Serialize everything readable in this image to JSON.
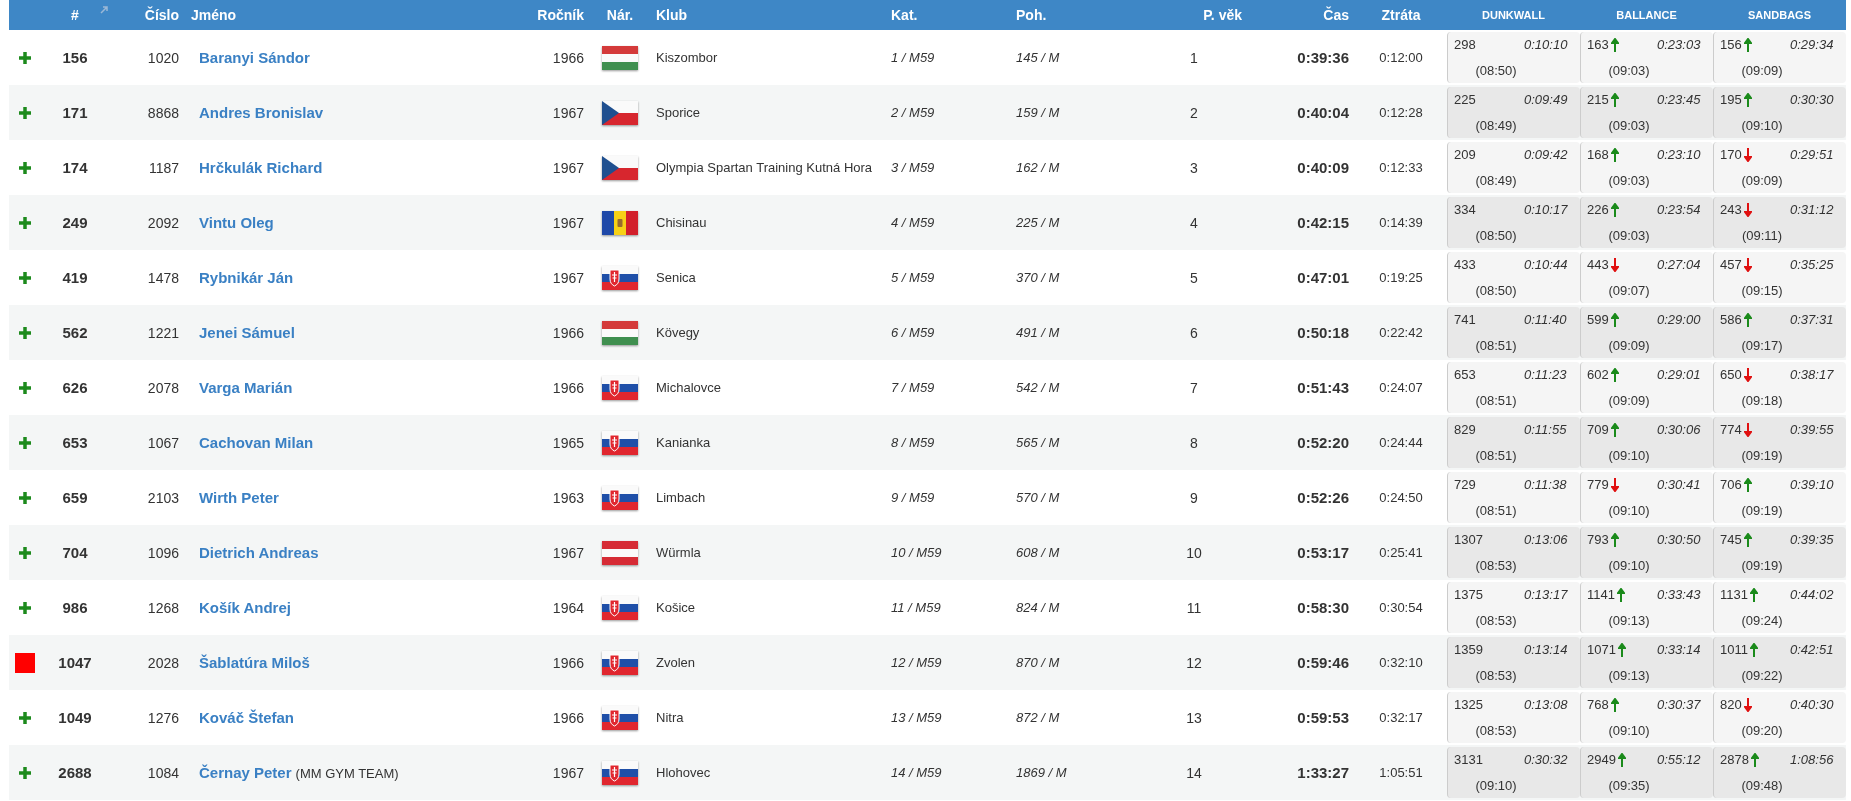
{
  "table": {
    "columns": [
      "#",
      "Číslo",
      "Jméno",
      "Ročník",
      "Nár.",
      "Klub",
      "Kat.",
      "Poh.",
      "P. věk",
      "Čas",
      "Ztráta"
    ],
    "split_columns": [
      "DUNKWALL",
      "BALLANCE",
      "SANDBAGS"
    ],
    "rows": [
      {
        "kind": "plus",
        "rank": "156",
        "number": "1020",
        "name": "Baranyi Sándor",
        "year": "1966",
        "flag": {
          "kind": "hu"
        },
        "club": "Kiszombor",
        "category": "1 / M59",
        "gender": "145 / M",
        "age_rank": "1",
        "time": "0:39:36",
        "loss": "0:12:00",
        "splits": [
          {
            "rank": "298",
            "time": "0:10:10",
            "lap": "(08:50)"
          },
          {
            "rank": "163",
            "improved": true,
            "time": "0:23:03",
            "lap": "(09:03)"
          },
          {
            "rank": "156",
            "improved": true,
            "time": "0:29:34",
            "lap": "(09:09)"
          }
        ]
      },
      {
        "kind": "plus",
        "rank": "171",
        "number": "8868",
        "name": "Andres Bronislav",
        "year": "1967",
        "flag": {
          "kind": "cz"
        },
        "club": "Sporice",
        "category": "2 / M59",
        "gender": "159 / M",
        "age_rank": "2",
        "time": "0:40:04",
        "loss": "0:12:28",
        "splits": [
          {
            "rank": "225",
            "time": "0:09:49",
            "lap": "(08:49)"
          },
          {
            "rank": "215",
            "improved": true,
            "time": "0:23:45",
            "lap": "(09:03)"
          },
          {
            "rank": "195",
            "improved": true,
            "time": "0:30:30",
            "lap": "(09:10)"
          }
        ]
      },
      {
        "kind": "plus",
        "rank": "174",
        "number": "1187",
        "name": "Hrčkulák Richard",
        "year": "1967",
        "flag": {
          "kind": "cz"
        },
        "club": "Olympia Spartan Training Kutná Hora",
        "category": "3 / M59",
        "gender": "162 / M",
        "age_rank": "3",
        "time": "0:40:09",
        "loss": "0:12:33",
        "splits": [
          {
            "rank": "209",
            "time": "0:09:42",
            "lap": "(08:49)"
          },
          {
            "rank": "168",
            "improved": true,
            "time": "0:23:10",
            "lap": "(09:03)"
          },
          {
            "rank": "170",
            "improved": false,
            "time": "0:29:51",
            "lap": "(09:09)"
          }
        ]
      },
      {
        "kind": "plus",
        "rank": "249",
        "number": "2092",
        "name": "Vintu Oleg",
        "year": "1967",
        "flag": {
          "kind": "md"
        },
        "club": "Chisinau",
        "category": "4 / M59",
        "gender": "225 / M",
        "age_rank": "4",
        "time": "0:42:15",
        "loss": "0:14:39",
        "splits": [
          {
            "rank": "334",
            "time": "0:10:17",
            "lap": "(08:50)"
          },
          {
            "rank": "226",
            "improved": true,
            "time": "0:23:54",
            "lap": "(09:03)"
          },
          {
            "rank": "243",
            "improved": false,
            "time": "0:31:12",
            "lap": "(09:11)"
          }
        ]
      },
      {
        "kind": "plus",
        "rank": "419",
        "number": "1478",
        "name": "Rybnikár Ján",
        "year": "1967",
        "flag": {
          "kind": "sk"
        },
        "club": "Senica",
        "category": "5 / M59",
        "gender": "370 / M",
        "age_rank": "5",
        "time": "0:47:01",
        "loss": "0:19:25",
        "splits": [
          {
            "rank": "433",
            "time": "0:10:44",
            "lap": "(08:50)"
          },
          {
            "rank": "443",
            "improved": false,
            "time": "0:27:04",
            "lap": "(09:07)"
          },
          {
            "rank": "457",
            "improved": false,
            "time": "0:35:25",
            "lap": "(09:15)"
          }
        ]
      },
      {
        "kind": "plus",
        "rank": "562",
        "number": "1221",
        "name": "Jenei Sámuel",
        "year": "1966",
        "flag": {
          "kind": "hu"
        },
        "club": "Kövegy",
        "category": "6 / M59",
        "gender": "491 / M",
        "age_rank": "6",
        "time": "0:50:18",
        "loss": "0:22:42",
        "splits": [
          {
            "rank": "741",
            "time": "0:11:40",
            "lap": "(08:51)"
          },
          {
            "rank": "599",
            "improved": true,
            "time": "0:29:00",
            "lap": "(09:09)"
          },
          {
            "rank": "586",
            "improved": true,
            "time": "0:37:31",
            "lap": "(09:17)"
          }
        ]
      },
      {
        "kind": "plus",
        "rank": "626",
        "number": "2078",
        "name": "Varga Marián",
        "year": "1966",
        "flag": {
          "kind": "sk"
        },
        "club": "Michalovce",
        "category": "7 / M59",
        "gender": "542 / M",
        "age_rank": "7",
        "time": "0:51:43",
        "loss": "0:24:07",
        "splits": [
          {
            "rank": "653",
            "time": "0:11:23",
            "lap": "(08:51)"
          },
          {
            "rank": "602",
            "improved": true,
            "time": "0:29:01",
            "lap": "(09:09)"
          },
          {
            "rank": "650",
            "improved": false,
            "time": "0:38:17",
            "lap": "(09:18)"
          }
        ]
      },
      {
        "kind": "plus",
        "rank": "653",
        "number": "1067",
        "name": "Cachovan Milan",
        "year": "1965",
        "flag": {
          "kind": "sk"
        },
        "club": "Kanianka",
        "category": "8 / M59",
        "gender": "565 / M",
        "age_rank": "8",
        "time": "0:52:20",
        "loss": "0:24:44",
        "splits": [
          {
            "rank": "829",
            "time": "0:11:55",
            "lap": "(08:51)"
          },
          {
            "rank": "709",
            "improved": true,
            "time": "0:30:06",
            "lap": "(09:10)"
          },
          {
            "rank": "774",
            "improved": false,
            "time": "0:39:55",
            "lap": "(09:19)"
          }
        ]
      },
      {
        "kind": "plus",
        "rank": "659",
        "number": "2103",
        "name": "Wirth Peter",
        "year": "1963",
        "flag": {
          "kind": "sk"
        },
        "club": "Limbach",
        "category": "9 / M59",
        "gender": "570 / M",
        "age_rank": "9",
        "time": "0:52:26",
        "loss": "0:24:50",
        "splits": [
          {
            "rank": "729",
            "time": "0:11:38",
            "lap": "(08:51)"
          },
          {
            "rank": "779",
            "improved": false,
            "time": "0:30:41",
            "lap": "(09:10)"
          },
          {
            "rank": "706",
            "improved": true,
            "time": "0:39:10",
            "lap": "(09:19)"
          }
        ]
      },
      {
        "kind": "plus",
        "rank": "704",
        "number": "1096",
        "name": "Dietrich Andreas",
        "year": "1967",
        "flag": {
          "kind": "at"
        },
        "club": "Würmla",
        "category": "10 / M59",
        "gender": "608 / M",
        "age_rank": "10",
        "time": "0:53:17",
        "loss": "0:25:41",
        "splits": [
          {
            "rank": "1307",
            "time": "0:13:06",
            "lap": "(08:53)"
          },
          {
            "rank": "793",
            "improved": true,
            "time": "0:30:50",
            "lap": "(09:10)"
          },
          {
            "rank": "745",
            "improved": true,
            "time": "0:39:35",
            "lap": "(09:19)"
          }
        ]
      },
      {
        "kind": "plus",
        "rank": "986",
        "number": "1268",
        "name": "Košík Andrej",
        "year": "1964",
        "flag": {
          "kind": "sk"
        },
        "club": "Košice",
        "category": "11 / M59",
        "gender": "824 / M",
        "age_rank": "11",
        "time": "0:58:30",
        "loss": "0:30:54",
        "splits": [
          {
            "rank": "1375",
            "time": "0:13:17",
            "lap": "(08:53)"
          },
          {
            "rank": "1141",
            "improved": true,
            "time": "0:33:43",
            "lap": "(09:13)"
          },
          {
            "rank": "1131",
            "improved": true,
            "time": "0:44:02",
            "lap": "(09:24)"
          }
        ]
      },
      {
        "kind": "square",
        "rank": "1047",
        "number": "2028",
        "name": "Šablatúra Miloš",
        "year": "1966",
        "flag": {
          "kind": "sk"
        },
        "club": "Zvolen",
        "category": "12 / M59",
        "gender": "870 / M",
        "age_rank": "12",
        "time": "0:59:46",
        "loss": "0:32:10",
        "splits": [
          {
            "rank": "1359",
            "time": "0:13:14",
            "lap": "(08:53)"
          },
          {
            "rank": "1071",
            "improved": true,
            "time": "0:33:14",
            "lap": "(09:13)"
          },
          {
            "rank": "1011",
            "improved": true,
            "time": "0:42:51",
            "lap": "(09:22)"
          }
        ]
      },
      {
        "kind": "plus",
        "rank": "1049",
        "number": "1276",
        "name": "Kováč Štefan",
        "year": "1966",
        "flag": {
          "kind": "sk"
        },
        "club": "Nitra",
        "category": "13 / M59",
        "gender": "872 / M",
        "age_rank": "13",
        "time": "0:59:53",
        "loss": "0:32:17",
        "splits": [
          {
            "rank": "1325",
            "time": "0:13:08",
            "lap": "(08:53)"
          },
          {
            "rank": "768",
            "improved": true,
            "time": "0:30:37",
            "lap": "(09:10)"
          },
          {
            "rank": "820",
            "improved": false,
            "time": "0:40:30",
            "lap": "(09:20)"
          }
        ]
      },
      {
        "kind": "plus",
        "rank": "2688",
        "number": "1084",
        "name": "Černay Peter",
        "team": "(MM GYM TEAM)",
        "year": "1967",
        "flag": {
          "kind": "sk"
        },
        "club": "Hlohovec",
        "category": "14 / M59",
        "gender": "1869 / M",
        "age_rank": "14",
        "time": "1:33:27",
        "loss": "1:05:51",
        "splits": [
          {
            "rank": "3131",
            "time": "0:30:32",
            "lap": "(09:10)"
          },
          {
            "rank": "2949",
            "improved": true,
            "time": "0:55:12",
            "lap": "(09:35)"
          },
          {
            "rank": "2878",
            "improved": true,
            "time": "1:08:56",
            "lap": "(09:48)"
          }
        ]
      }
    ]
  }
}
